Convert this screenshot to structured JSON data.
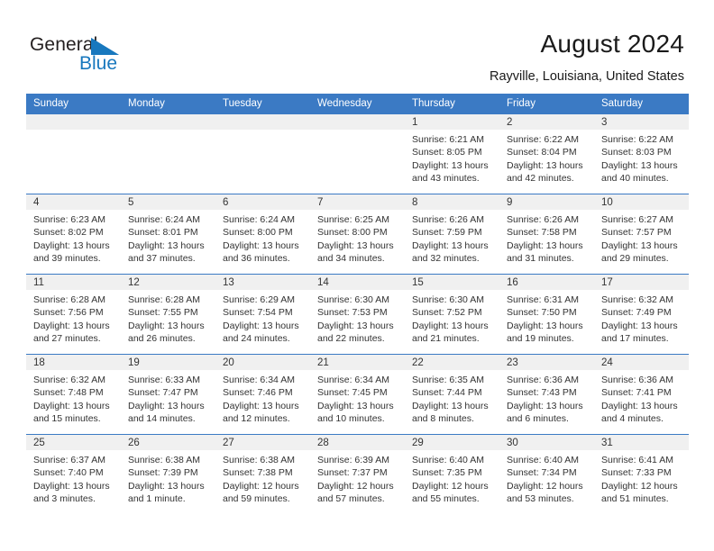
{
  "brand": {
    "name_part1": "General",
    "name_part2": "Blue",
    "triangle_color": "#1878be",
    "text_color": "#231f20"
  },
  "header": {
    "title": "August 2024",
    "subtitle": "Rayville, Louisiana, United States",
    "accent_color": "#3b7ac4"
  },
  "weekday_headers": [
    "Sunday",
    "Monday",
    "Tuesday",
    "Wednesday",
    "Thursday",
    "Friday",
    "Saturday"
  ],
  "weeks": [
    [
      {
        "day": "",
        "lines": []
      },
      {
        "day": "",
        "lines": []
      },
      {
        "day": "",
        "lines": []
      },
      {
        "day": "",
        "lines": []
      },
      {
        "day": "1",
        "lines": [
          "Sunrise: 6:21 AM",
          "Sunset: 8:05 PM",
          "Daylight: 13 hours",
          "and 43 minutes."
        ]
      },
      {
        "day": "2",
        "lines": [
          "Sunrise: 6:22 AM",
          "Sunset: 8:04 PM",
          "Daylight: 13 hours",
          "and 42 minutes."
        ]
      },
      {
        "day": "3",
        "lines": [
          "Sunrise: 6:22 AM",
          "Sunset: 8:03 PM",
          "Daylight: 13 hours",
          "and 40 minutes."
        ]
      }
    ],
    [
      {
        "day": "4",
        "lines": [
          "Sunrise: 6:23 AM",
          "Sunset: 8:02 PM",
          "Daylight: 13 hours",
          "and 39 minutes."
        ]
      },
      {
        "day": "5",
        "lines": [
          "Sunrise: 6:24 AM",
          "Sunset: 8:01 PM",
          "Daylight: 13 hours",
          "and 37 minutes."
        ]
      },
      {
        "day": "6",
        "lines": [
          "Sunrise: 6:24 AM",
          "Sunset: 8:00 PM",
          "Daylight: 13 hours",
          "and 36 minutes."
        ]
      },
      {
        "day": "7",
        "lines": [
          "Sunrise: 6:25 AM",
          "Sunset: 8:00 PM",
          "Daylight: 13 hours",
          "and 34 minutes."
        ]
      },
      {
        "day": "8",
        "lines": [
          "Sunrise: 6:26 AM",
          "Sunset: 7:59 PM",
          "Daylight: 13 hours",
          "and 32 minutes."
        ]
      },
      {
        "day": "9",
        "lines": [
          "Sunrise: 6:26 AM",
          "Sunset: 7:58 PM",
          "Daylight: 13 hours",
          "and 31 minutes."
        ]
      },
      {
        "day": "10",
        "lines": [
          "Sunrise: 6:27 AM",
          "Sunset: 7:57 PM",
          "Daylight: 13 hours",
          "and 29 minutes."
        ]
      }
    ],
    [
      {
        "day": "11",
        "lines": [
          "Sunrise: 6:28 AM",
          "Sunset: 7:56 PM",
          "Daylight: 13 hours",
          "and 27 minutes."
        ]
      },
      {
        "day": "12",
        "lines": [
          "Sunrise: 6:28 AM",
          "Sunset: 7:55 PM",
          "Daylight: 13 hours",
          "and 26 minutes."
        ]
      },
      {
        "day": "13",
        "lines": [
          "Sunrise: 6:29 AM",
          "Sunset: 7:54 PM",
          "Daylight: 13 hours",
          "and 24 minutes."
        ]
      },
      {
        "day": "14",
        "lines": [
          "Sunrise: 6:30 AM",
          "Sunset: 7:53 PM",
          "Daylight: 13 hours",
          "and 22 minutes."
        ]
      },
      {
        "day": "15",
        "lines": [
          "Sunrise: 6:30 AM",
          "Sunset: 7:52 PM",
          "Daylight: 13 hours",
          "and 21 minutes."
        ]
      },
      {
        "day": "16",
        "lines": [
          "Sunrise: 6:31 AM",
          "Sunset: 7:50 PM",
          "Daylight: 13 hours",
          "and 19 minutes."
        ]
      },
      {
        "day": "17",
        "lines": [
          "Sunrise: 6:32 AM",
          "Sunset: 7:49 PM",
          "Daylight: 13 hours",
          "and 17 minutes."
        ]
      }
    ],
    [
      {
        "day": "18",
        "lines": [
          "Sunrise: 6:32 AM",
          "Sunset: 7:48 PM",
          "Daylight: 13 hours",
          "and 15 minutes."
        ]
      },
      {
        "day": "19",
        "lines": [
          "Sunrise: 6:33 AM",
          "Sunset: 7:47 PM",
          "Daylight: 13 hours",
          "and 14 minutes."
        ]
      },
      {
        "day": "20",
        "lines": [
          "Sunrise: 6:34 AM",
          "Sunset: 7:46 PM",
          "Daylight: 13 hours",
          "and 12 minutes."
        ]
      },
      {
        "day": "21",
        "lines": [
          "Sunrise: 6:34 AM",
          "Sunset: 7:45 PM",
          "Daylight: 13 hours",
          "and 10 minutes."
        ]
      },
      {
        "day": "22",
        "lines": [
          "Sunrise: 6:35 AM",
          "Sunset: 7:44 PM",
          "Daylight: 13 hours",
          "and 8 minutes."
        ]
      },
      {
        "day": "23",
        "lines": [
          "Sunrise: 6:36 AM",
          "Sunset: 7:43 PM",
          "Daylight: 13 hours",
          "and 6 minutes."
        ]
      },
      {
        "day": "24",
        "lines": [
          "Sunrise: 6:36 AM",
          "Sunset: 7:41 PM",
          "Daylight: 13 hours",
          "and 4 minutes."
        ]
      }
    ],
    [
      {
        "day": "25",
        "lines": [
          "Sunrise: 6:37 AM",
          "Sunset: 7:40 PM",
          "Daylight: 13 hours",
          "and 3 minutes."
        ]
      },
      {
        "day": "26",
        "lines": [
          "Sunrise: 6:38 AM",
          "Sunset: 7:39 PM",
          "Daylight: 13 hours",
          "and 1 minute."
        ]
      },
      {
        "day": "27",
        "lines": [
          "Sunrise: 6:38 AM",
          "Sunset: 7:38 PM",
          "Daylight: 12 hours",
          "and 59 minutes."
        ]
      },
      {
        "day": "28",
        "lines": [
          "Sunrise: 6:39 AM",
          "Sunset: 7:37 PM",
          "Daylight: 12 hours",
          "and 57 minutes."
        ]
      },
      {
        "day": "29",
        "lines": [
          "Sunrise: 6:40 AM",
          "Sunset: 7:35 PM",
          "Daylight: 12 hours",
          "and 55 minutes."
        ]
      },
      {
        "day": "30",
        "lines": [
          "Sunrise: 6:40 AM",
          "Sunset: 7:34 PM",
          "Daylight: 12 hours",
          "and 53 minutes."
        ]
      },
      {
        "day": "31",
        "lines": [
          "Sunrise: 6:41 AM",
          "Sunset: 7:33 PM",
          "Daylight: 12 hours",
          "and 51 minutes."
        ]
      }
    ]
  ]
}
